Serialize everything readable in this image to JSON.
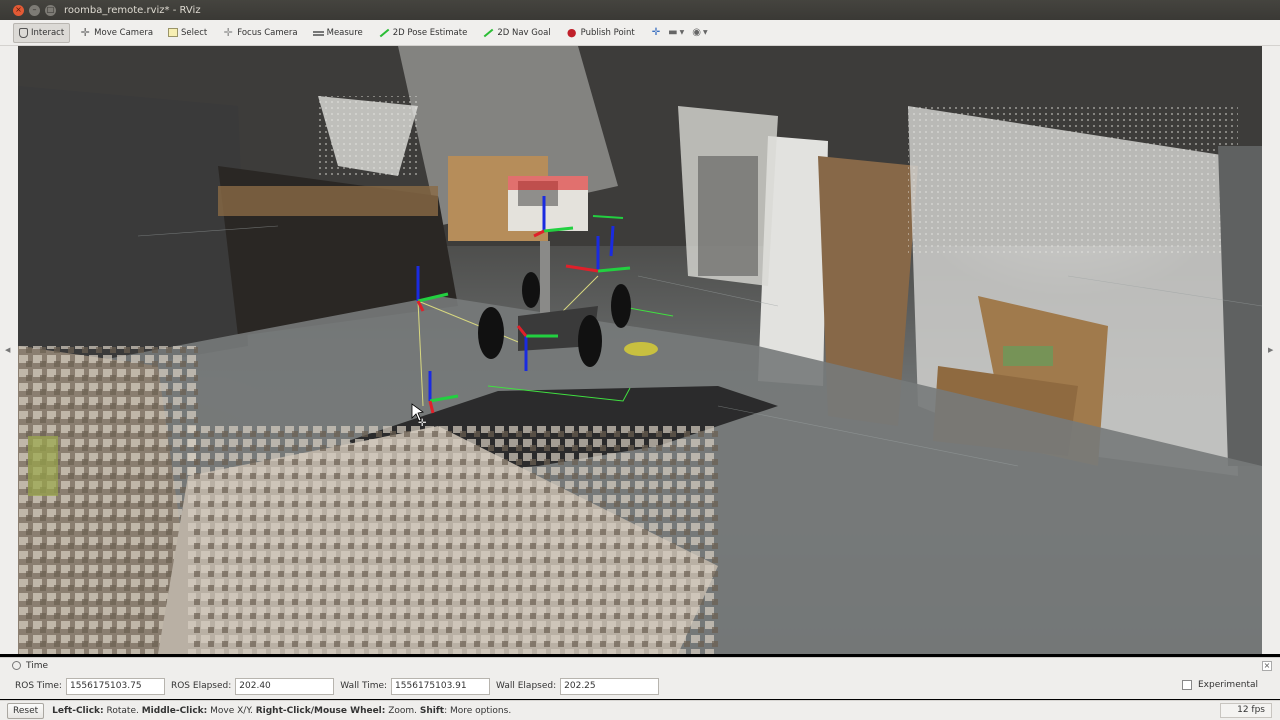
{
  "window": {
    "title": "roomba_remote.rviz* - RViz",
    "close_glyph": "×",
    "min_glyph": "–",
    "max_glyph": "□"
  },
  "toolbar": {
    "tools": [
      {
        "label": "Interact",
        "icon": "hand-icon",
        "active": true
      },
      {
        "label": "Move Camera",
        "icon": "move-camera-icon"
      },
      {
        "label": "Select",
        "icon": "select-icon"
      },
      {
        "label": "Focus Camera",
        "icon": "focus-camera-icon"
      },
      {
        "label": "Measure",
        "icon": "measure-icon"
      },
      {
        "label": "2D Pose Estimate",
        "icon": "green-arrow-icon"
      },
      {
        "label": "2D Nav Goal",
        "icon": "green-arrow-icon"
      },
      {
        "label": "Publish Point",
        "icon": "pin-icon"
      }
    ],
    "add_tool_glyph": "✛",
    "remove_tool_glyph": "▬",
    "view_glyph": "◉",
    "caret_glyph": "▼"
  },
  "time_panel": {
    "title": "Time",
    "close_glyph": "×",
    "ros_time_label": "ROS Time:",
    "ros_time": "1556175103.75",
    "ros_elapsed_label": "ROS Elapsed:",
    "ros_elapsed": "202.40",
    "wall_time_label": "Wall Time:",
    "wall_time": "1556175103.91",
    "wall_elapsed_label": "Wall Elapsed:",
    "wall_elapsed": "202.25",
    "experimental_label": "Experimental",
    "experimental_checked": false
  },
  "statusbar": {
    "reset_label": "Reset",
    "hint_parts": [
      {
        "text": "Left-Click:",
        "bold": true
      },
      {
        "text": " Rotate. ",
        "bold": false
      },
      {
        "text": "Middle-Click:",
        "bold": true
      },
      {
        "text": " Move X/Y. ",
        "bold": false
      },
      {
        "text": "Right-Click/Mouse Wheel:",
        "bold": true
      },
      {
        "text": ": Zoom. ",
        "bold": false
      },
      {
        "text": "Shift",
        "bold": true
      },
      {
        "text": ": More options.",
        "bold": false
      }
    ],
    "fps": "12 fps"
  },
  "colors": {
    "axis_x": "#e0202a",
    "axis_y": "#22d040",
    "axis_z": "#1a2be0",
    "link_line": "#d8d880",
    "footprint": "#40e040",
    "goal_marker": "#c8c040"
  }
}
